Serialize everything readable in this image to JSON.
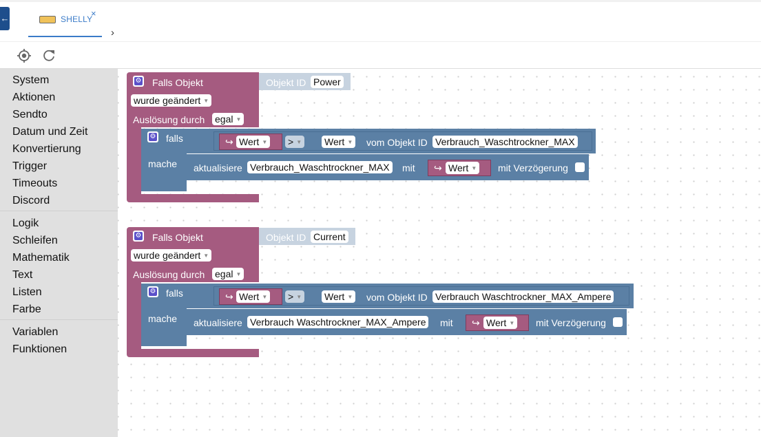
{
  "tabbar": {
    "back_label": "←",
    "tab_label": "SHELLY",
    "tab_close": "×",
    "scroll_right": "›"
  },
  "toolbar": {
    "target_icon": "crosshair-icon",
    "refresh_icon": "refresh-icon"
  },
  "sidebar": {
    "groups": [
      [
        "System",
        "Aktionen",
        "Sendto",
        "Datum und Zeit",
        "Konvertierung",
        "Trigger",
        "Timeouts",
        "Discord"
      ],
      [
        "Logik",
        "Schleifen",
        "Mathematik",
        "Text",
        "Listen",
        "Farbe"
      ],
      [
        "Variablen",
        "Funktionen"
      ]
    ]
  },
  "blocks": [
    {
      "header": "Falls Objekt",
      "objekt_id_label": "Objekt ID",
      "objekt_id": "Power",
      "change_dropdown": "wurde geändert",
      "trigger_label": "Auslösung durch",
      "trigger_dropdown": "egal",
      "if_label": "falls",
      "do_label": "mache",
      "var1": "Wert",
      "op": ">",
      "var2": "Wert",
      "vom_label": "vom Objekt ID",
      "compare_id": "Verbrauch_Waschtrockner_MAX",
      "update_label": "aktualisiere",
      "update_id": "Verbrauch_Waschtrockner_MAX",
      "mit_label": "mit",
      "var3": "Wert",
      "delay_label": "mit Verzögerung"
    },
    {
      "header": "Falls Objekt",
      "objekt_id_label": "Objekt ID",
      "objekt_id": "Current",
      "change_dropdown": "wurde geändert",
      "trigger_label": "Auslösung durch",
      "trigger_dropdown": "egal",
      "if_label": "falls",
      "do_label": "mache",
      "var1": "Wert",
      "op": ">",
      "var2": "Wert",
      "vom_label": "vom Objekt ID",
      "compare_id": "Verbrauch Waschtrockner_MAX_Ampere",
      "update_label": "aktualisiere",
      "update_id": "Verbrauch Waschtrockner_MAX_Ampere",
      "mit_label": "mit",
      "var3": "Wert",
      "delay_label": "mit Verzögerung"
    }
  ],
  "colors": {
    "event_block": "#a55b80",
    "logic_block": "#5b80a5",
    "sidebar_bg": "#e0e0e0",
    "tab_accent": "#3a7bc8"
  }
}
